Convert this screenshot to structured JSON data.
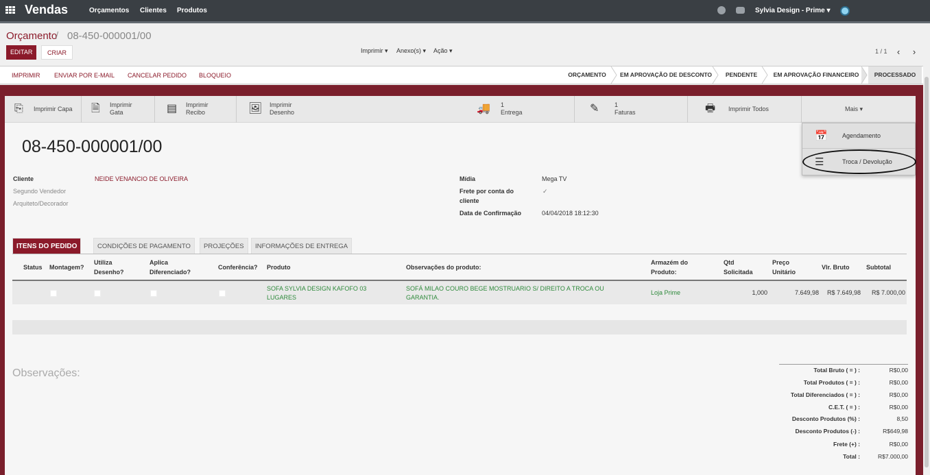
{
  "topbar": {
    "brand": "Vendas",
    "menu": [
      "Orçamentos",
      "Clientes",
      "Produtos"
    ],
    "user": "Sylvia Design - Prime ▾"
  },
  "control_panel": {
    "breadcrumb_root": "Orçamento",
    "breadcrumb_sep": "/",
    "breadcrumb_current": "08-450-000001/00",
    "edit_label": "EDITAR",
    "create_label": "CRIAR",
    "print_dd": "Imprimir ▾",
    "attach_dd": "Anexo(s) ▾",
    "action_dd": "Ação ▾",
    "pager": "1 / 1",
    "prev": "‹",
    "next": "›"
  },
  "statusbar": {
    "actions": [
      "IMPRIMIR",
      "ENVIAR POR E-MAIL",
      "CANCELAR PEDIDO",
      "BLOQUEIO"
    ],
    "stages": [
      "ORÇAMENTO",
      "EM APROVAÇÃO DE DESCONTO",
      "PENDENTE",
      "EM APROVAÇÃO FINANCEIRO",
      "PROCESSADO"
    ],
    "active_stage": "PROCESSADO"
  },
  "button_box": {
    "print_cover": "Imprimir Capa",
    "print_gata_1": "Imprimir",
    "print_gata_2": "Gata",
    "print_receipt_1": "Imprimir",
    "print_receipt_2": "Recibo",
    "print_drawing_1": "Imprimir",
    "print_drawing_2": "Desenho",
    "delivery_count": "1",
    "delivery_label": "Entrega",
    "invoice_count": "1",
    "invoice_label": "Faturas",
    "print_all": "Imprimir Todos",
    "more": "Mais ▾"
  },
  "more_menu": {
    "items": [
      "Agendamento",
      "Troca / Devolução"
    ]
  },
  "record": {
    "title": "08-450-000001/00",
    "client_label": "Cliente",
    "client_value": "NEIDE VENANCIO DE OLIVEIRA",
    "second_seller_label": "Segundo Vendedor",
    "architect_label": "Arquiteto/Decorador",
    "media_label": "Mídia",
    "media_value": "Mega TV",
    "freight_label_1": "Frete por conta do",
    "freight_label_2": "cliente",
    "confirm_label": "Data de Confirmação",
    "confirm_value": "04/04/2018 18:12:30"
  },
  "tabs": [
    "ITENS DO PEDIDO",
    "CONDIÇÕES DE PAGAMENTO",
    "PROJEÇÕES",
    "INFORMAÇÕES DE ENTREGA"
  ],
  "table": {
    "headers": {
      "status": "Status",
      "montagem": "Montagem?",
      "utiliza_1": "Utiliza",
      "utiliza_2": "Desenho?",
      "aplica_1": "Aplica",
      "aplica_2": "Diferenciado?",
      "conferencia": "Conferência?",
      "produto": "Produto",
      "obs": "Observações do produto:",
      "armazem_1": "Armazém do",
      "armazem_2": "Produto:",
      "qtd_1": "Qtd",
      "qtd_2": "Solicitada",
      "preco_1": "Preço",
      "preco_2": "Unitário",
      "bruto": "Vlr. Bruto",
      "subtotal": "Subtotal"
    },
    "row": {
      "produto_1": "SOFA SYLVIA DESIGN KAFOFO 03",
      "produto_2": "LUGARES",
      "obs_1": "SOFÁ MILAO COURO BEGE MOSTRUARIO S/ DIREITO A TROCA OU",
      "obs_2": "GARANTIA.",
      "armazem": "Loja Prime",
      "qtd": "1,000",
      "preco": "7.649,98",
      "bruto": "R$ 7.649,98",
      "subtotal": "R$ 7.000,00"
    }
  },
  "observacoes_label": "Observações:",
  "totals": [
    {
      "label": "Total Bruto ( = ) :",
      "value": "R$0,00"
    },
    {
      "label": "Total Produtos ( = ) :",
      "value": "R$0,00"
    },
    {
      "label": "Total Diferenciados ( = ) :",
      "value": "R$0,00"
    },
    {
      "label": "C.E.T. ( = ) :",
      "value": "R$0,00"
    },
    {
      "label": "Desconto Produtos (%) :",
      "value": "8,50"
    },
    {
      "label": "Desconto Produtos (-) :",
      "value": "R$649,98"
    },
    {
      "label": "Frete (+) :",
      "value": "R$0,00"
    },
    {
      "label": "Total :",
      "value": "R$7.000,00"
    }
  ],
  "colors": {
    "brand": "#8b1a2a",
    "topbar": "#3a3f44",
    "sheet_frame": "#7a1f2c",
    "link_green": "#2f8a3c"
  }
}
